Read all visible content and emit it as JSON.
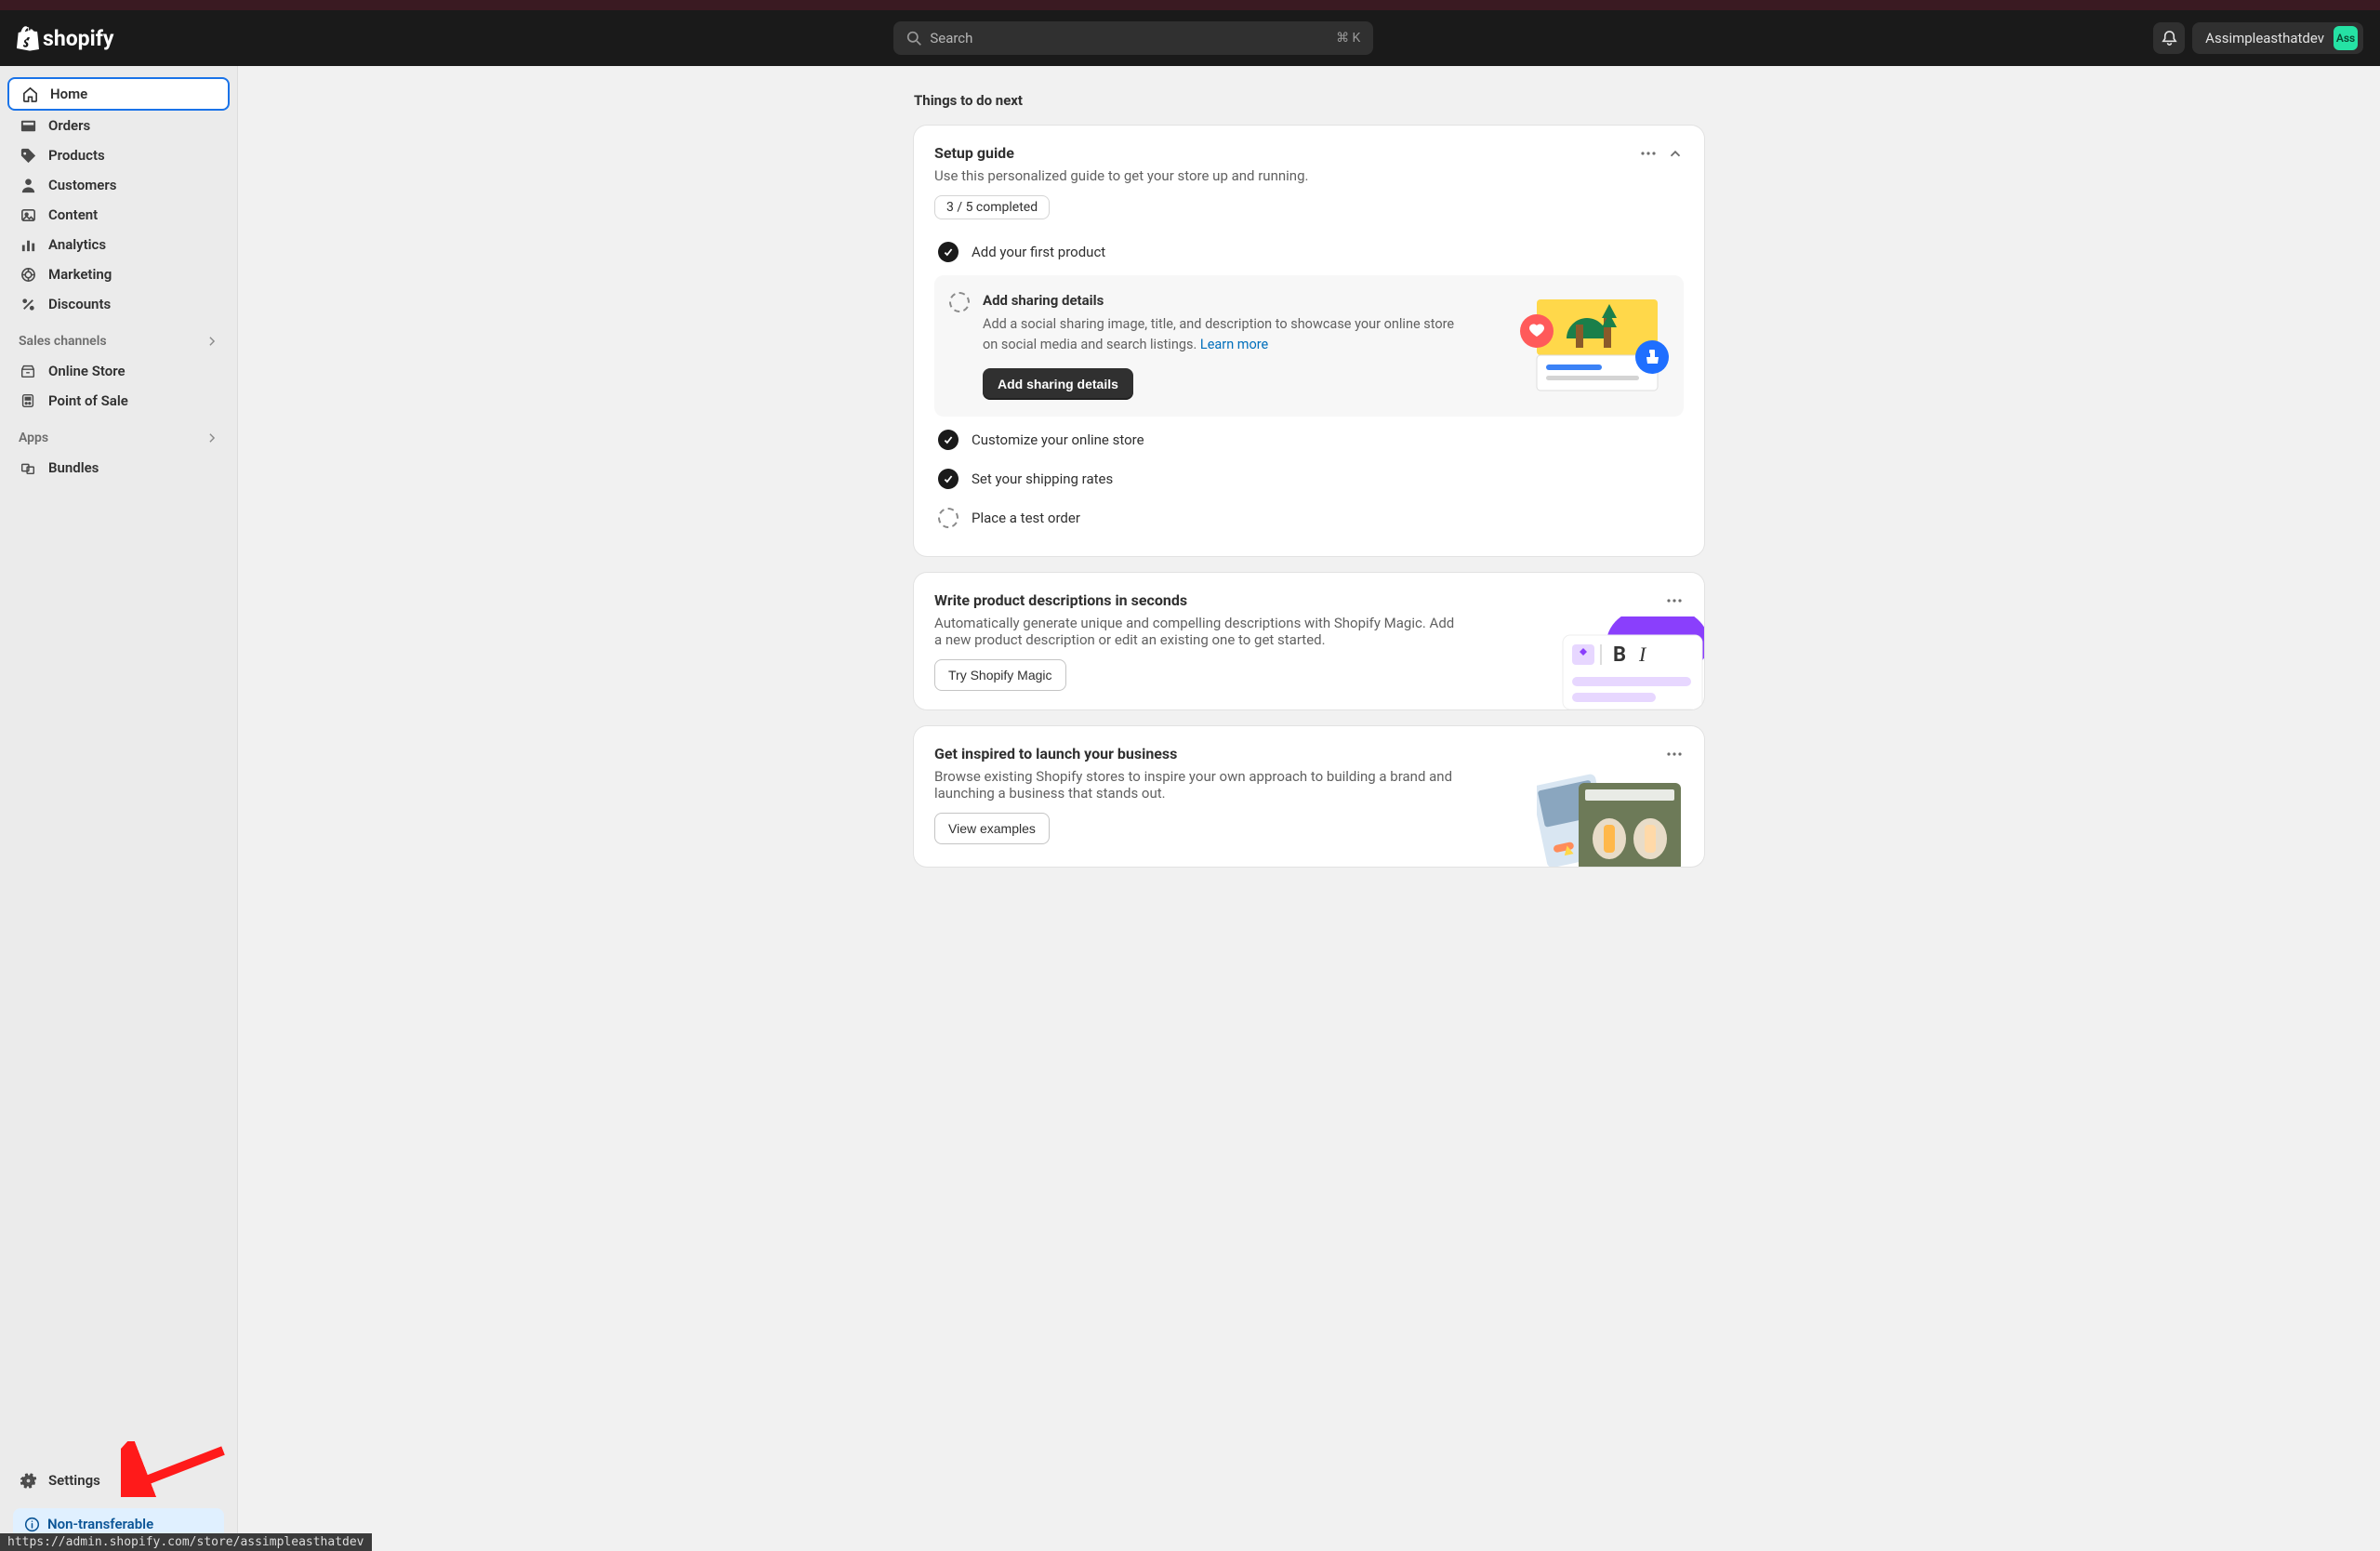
{
  "header": {
    "brand": "shopify",
    "search_placeholder": "Search",
    "search_shortcut": "⌘ K",
    "store_name": "Assimpleasthatdev",
    "avatar_initials": "Ass"
  },
  "sidebar": {
    "nav": [
      {
        "label": "Home",
        "icon": "home",
        "active": true
      },
      {
        "label": "Orders",
        "icon": "inbox"
      },
      {
        "label": "Products",
        "icon": "tag"
      },
      {
        "label": "Customers",
        "icon": "person"
      },
      {
        "label": "Content",
        "icon": "image"
      },
      {
        "label": "Analytics",
        "icon": "bars"
      },
      {
        "label": "Marketing",
        "icon": "target"
      },
      {
        "label": "Discounts",
        "icon": "percent"
      }
    ],
    "sections": [
      {
        "label": "Sales channels",
        "items": [
          {
            "label": "Online Store",
            "icon": "store"
          },
          {
            "label": "Point of Sale",
            "icon": "pos"
          }
        ]
      },
      {
        "label": "Apps",
        "items": [
          {
            "label": "Bundles",
            "icon": "bundle"
          }
        ]
      }
    ],
    "settings_label": "Settings",
    "nontransferable": "Non-transferable",
    "status_url": "https://admin.shopify.com/store/assimpleasthatdev"
  },
  "main": {
    "section_title": "Things to do next",
    "setup": {
      "title": "Setup guide",
      "subtitle": "Use this personalized guide to get your store up and running.",
      "progress": "3 / 5 completed",
      "tasks": [
        {
          "title": "Add your first product",
          "state": "done"
        },
        {
          "title": "Add sharing details",
          "state": "current",
          "desc": "Add a social sharing image, title, and description to showcase your online store on social media and search listings.",
          "learn_more": "Learn more",
          "cta": "Add sharing details"
        },
        {
          "title": "Customize your online store",
          "state": "done"
        },
        {
          "title": "Set your shipping rates",
          "state": "done"
        },
        {
          "title": "Place a test order",
          "state": "pending"
        }
      ]
    },
    "magic": {
      "title": "Write product descriptions in seconds",
      "desc": "Automatically generate unique and compelling descriptions with Shopify Magic. Add a new product description or edit an existing one to get started.",
      "cta": "Try Shopify Magic"
    },
    "inspire": {
      "title": "Get inspired to launch your business",
      "desc": "Browse existing Shopify stores to inspire your own approach to building a brand and launching a business that stands out.",
      "cta": "View examples"
    }
  }
}
